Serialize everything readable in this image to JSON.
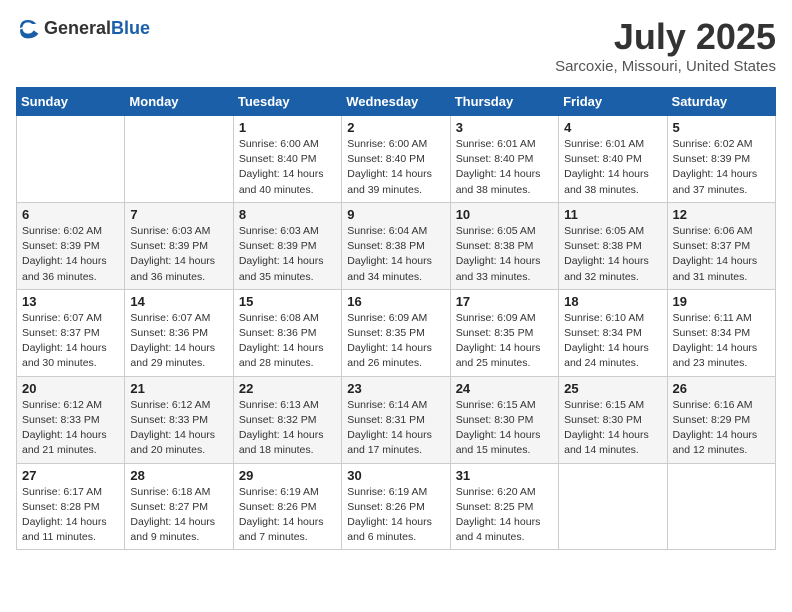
{
  "header": {
    "logo_general": "General",
    "logo_blue": "Blue",
    "title": "July 2025",
    "subtitle": "Sarcoxie, Missouri, United States"
  },
  "weekdays": [
    "Sunday",
    "Monday",
    "Tuesday",
    "Wednesday",
    "Thursday",
    "Friday",
    "Saturday"
  ],
  "weeks": [
    [
      {
        "day": "",
        "sunrise": "",
        "sunset": "",
        "daylight": ""
      },
      {
        "day": "",
        "sunrise": "",
        "sunset": "",
        "daylight": ""
      },
      {
        "day": "1",
        "sunrise": "Sunrise: 6:00 AM",
        "sunset": "Sunset: 8:40 PM",
        "daylight": "Daylight: 14 hours and 40 minutes."
      },
      {
        "day": "2",
        "sunrise": "Sunrise: 6:00 AM",
        "sunset": "Sunset: 8:40 PM",
        "daylight": "Daylight: 14 hours and 39 minutes."
      },
      {
        "day": "3",
        "sunrise": "Sunrise: 6:01 AM",
        "sunset": "Sunset: 8:40 PM",
        "daylight": "Daylight: 14 hours and 38 minutes."
      },
      {
        "day": "4",
        "sunrise": "Sunrise: 6:01 AM",
        "sunset": "Sunset: 8:40 PM",
        "daylight": "Daylight: 14 hours and 38 minutes."
      },
      {
        "day": "5",
        "sunrise": "Sunrise: 6:02 AM",
        "sunset": "Sunset: 8:39 PM",
        "daylight": "Daylight: 14 hours and 37 minutes."
      }
    ],
    [
      {
        "day": "6",
        "sunrise": "Sunrise: 6:02 AM",
        "sunset": "Sunset: 8:39 PM",
        "daylight": "Daylight: 14 hours and 36 minutes."
      },
      {
        "day": "7",
        "sunrise": "Sunrise: 6:03 AM",
        "sunset": "Sunset: 8:39 PM",
        "daylight": "Daylight: 14 hours and 36 minutes."
      },
      {
        "day": "8",
        "sunrise": "Sunrise: 6:03 AM",
        "sunset": "Sunset: 8:39 PM",
        "daylight": "Daylight: 14 hours and 35 minutes."
      },
      {
        "day": "9",
        "sunrise": "Sunrise: 6:04 AM",
        "sunset": "Sunset: 8:38 PM",
        "daylight": "Daylight: 14 hours and 34 minutes."
      },
      {
        "day": "10",
        "sunrise": "Sunrise: 6:05 AM",
        "sunset": "Sunset: 8:38 PM",
        "daylight": "Daylight: 14 hours and 33 minutes."
      },
      {
        "day": "11",
        "sunrise": "Sunrise: 6:05 AM",
        "sunset": "Sunset: 8:38 PM",
        "daylight": "Daylight: 14 hours and 32 minutes."
      },
      {
        "day": "12",
        "sunrise": "Sunrise: 6:06 AM",
        "sunset": "Sunset: 8:37 PM",
        "daylight": "Daylight: 14 hours and 31 minutes."
      }
    ],
    [
      {
        "day": "13",
        "sunrise": "Sunrise: 6:07 AM",
        "sunset": "Sunset: 8:37 PM",
        "daylight": "Daylight: 14 hours and 30 minutes."
      },
      {
        "day": "14",
        "sunrise": "Sunrise: 6:07 AM",
        "sunset": "Sunset: 8:36 PM",
        "daylight": "Daylight: 14 hours and 29 minutes."
      },
      {
        "day": "15",
        "sunrise": "Sunrise: 6:08 AM",
        "sunset": "Sunset: 8:36 PM",
        "daylight": "Daylight: 14 hours and 28 minutes."
      },
      {
        "day": "16",
        "sunrise": "Sunrise: 6:09 AM",
        "sunset": "Sunset: 8:35 PM",
        "daylight": "Daylight: 14 hours and 26 minutes."
      },
      {
        "day": "17",
        "sunrise": "Sunrise: 6:09 AM",
        "sunset": "Sunset: 8:35 PM",
        "daylight": "Daylight: 14 hours and 25 minutes."
      },
      {
        "day": "18",
        "sunrise": "Sunrise: 6:10 AM",
        "sunset": "Sunset: 8:34 PM",
        "daylight": "Daylight: 14 hours and 24 minutes."
      },
      {
        "day": "19",
        "sunrise": "Sunrise: 6:11 AM",
        "sunset": "Sunset: 8:34 PM",
        "daylight": "Daylight: 14 hours and 23 minutes."
      }
    ],
    [
      {
        "day": "20",
        "sunrise": "Sunrise: 6:12 AM",
        "sunset": "Sunset: 8:33 PM",
        "daylight": "Daylight: 14 hours and 21 minutes."
      },
      {
        "day": "21",
        "sunrise": "Sunrise: 6:12 AM",
        "sunset": "Sunset: 8:33 PM",
        "daylight": "Daylight: 14 hours and 20 minutes."
      },
      {
        "day": "22",
        "sunrise": "Sunrise: 6:13 AM",
        "sunset": "Sunset: 8:32 PM",
        "daylight": "Daylight: 14 hours and 18 minutes."
      },
      {
        "day": "23",
        "sunrise": "Sunrise: 6:14 AM",
        "sunset": "Sunset: 8:31 PM",
        "daylight": "Daylight: 14 hours and 17 minutes."
      },
      {
        "day": "24",
        "sunrise": "Sunrise: 6:15 AM",
        "sunset": "Sunset: 8:30 PM",
        "daylight": "Daylight: 14 hours and 15 minutes."
      },
      {
        "day": "25",
        "sunrise": "Sunrise: 6:15 AM",
        "sunset": "Sunset: 8:30 PM",
        "daylight": "Daylight: 14 hours and 14 minutes."
      },
      {
        "day": "26",
        "sunrise": "Sunrise: 6:16 AM",
        "sunset": "Sunset: 8:29 PM",
        "daylight": "Daylight: 14 hours and 12 minutes."
      }
    ],
    [
      {
        "day": "27",
        "sunrise": "Sunrise: 6:17 AM",
        "sunset": "Sunset: 8:28 PM",
        "daylight": "Daylight: 14 hours and 11 minutes."
      },
      {
        "day": "28",
        "sunrise": "Sunrise: 6:18 AM",
        "sunset": "Sunset: 8:27 PM",
        "daylight": "Daylight: 14 hours and 9 minutes."
      },
      {
        "day": "29",
        "sunrise": "Sunrise: 6:19 AM",
        "sunset": "Sunset: 8:26 PM",
        "daylight": "Daylight: 14 hours and 7 minutes."
      },
      {
        "day": "30",
        "sunrise": "Sunrise: 6:19 AM",
        "sunset": "Sunset: 8:26 PM",
        "daylight": "Daylight: 14 hours and 6 minutes."
      },
      {
        "day": "31",
        "sunrise": "Sunrise: 6:20 AM",
        "sunset": "Sunset: 8:25 PM",
        "daylight": "Daylight: 14 hours and 4 minutes."
      },
      {
        "day": "",
        "sunrise": "",
        "sunset": "",
        "daylight": ""
      },
      {
        "day": "",
        "sunrise": "",
        "sunset": "",
        "daylight": ""
      }
    ]
  ]
}
